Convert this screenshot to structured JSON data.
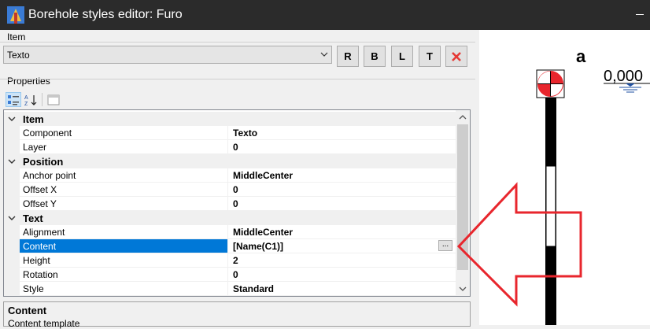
{
  "window": {
    "title": "Borehole styles editor: Furo"
  },
  "item_section": {
    "label": "Item",
    "combo_value": "Texto",
    "buttons": [
      "R",
      "B",
      "L",
      "T"
    ]
  },
  "properties_section": {
    "label": "Properties"
  },
  "grid": {
    "categories": [
      {
        "label": "Item",
        "props": [
          {
            "name": "Component",
            "value": "Texto"
          },
          {
            "name": "Layer",
            "value": "0"
          }
        ]
      },
      {
        "label": "Position",
        "props": [
          {
            "name": "Anchor point",
            "value": "MiddleCenter"
          },
          {
            "name": "Offset X",
            "value": "0"
          },
          {
            "name": "Offset Y",
            "value": "0"
          }
        ]
      },
      {
        "label": "Text",
        "props": [
          {
            "name": "Alignment",
            "value": "MiddleCenter"
          },
          {
            "name": "Content",
            "value": "[Name(C1)]",
            "ellipsis": "..."
          },
          {
            "name": "Height",
            "value": "2"
          },
          {
            "name": "Rotation",
            "value": "0"
          },
          {
            "name": "Style",
            "value": "Standard"
          }
        ]
      }
    ]
  },
  "description": {
    "title": "Content",
    "text": "Content template"
  },
  "preview": {
    "label": "a",
    "depth": "0,000"
  },
  "colors": {
    "titlebar": "#2b2b2b",
    "selection": "#0078d7",
    "arrow": "#e8262d",
    "delete": "#e53935"
  }
}
